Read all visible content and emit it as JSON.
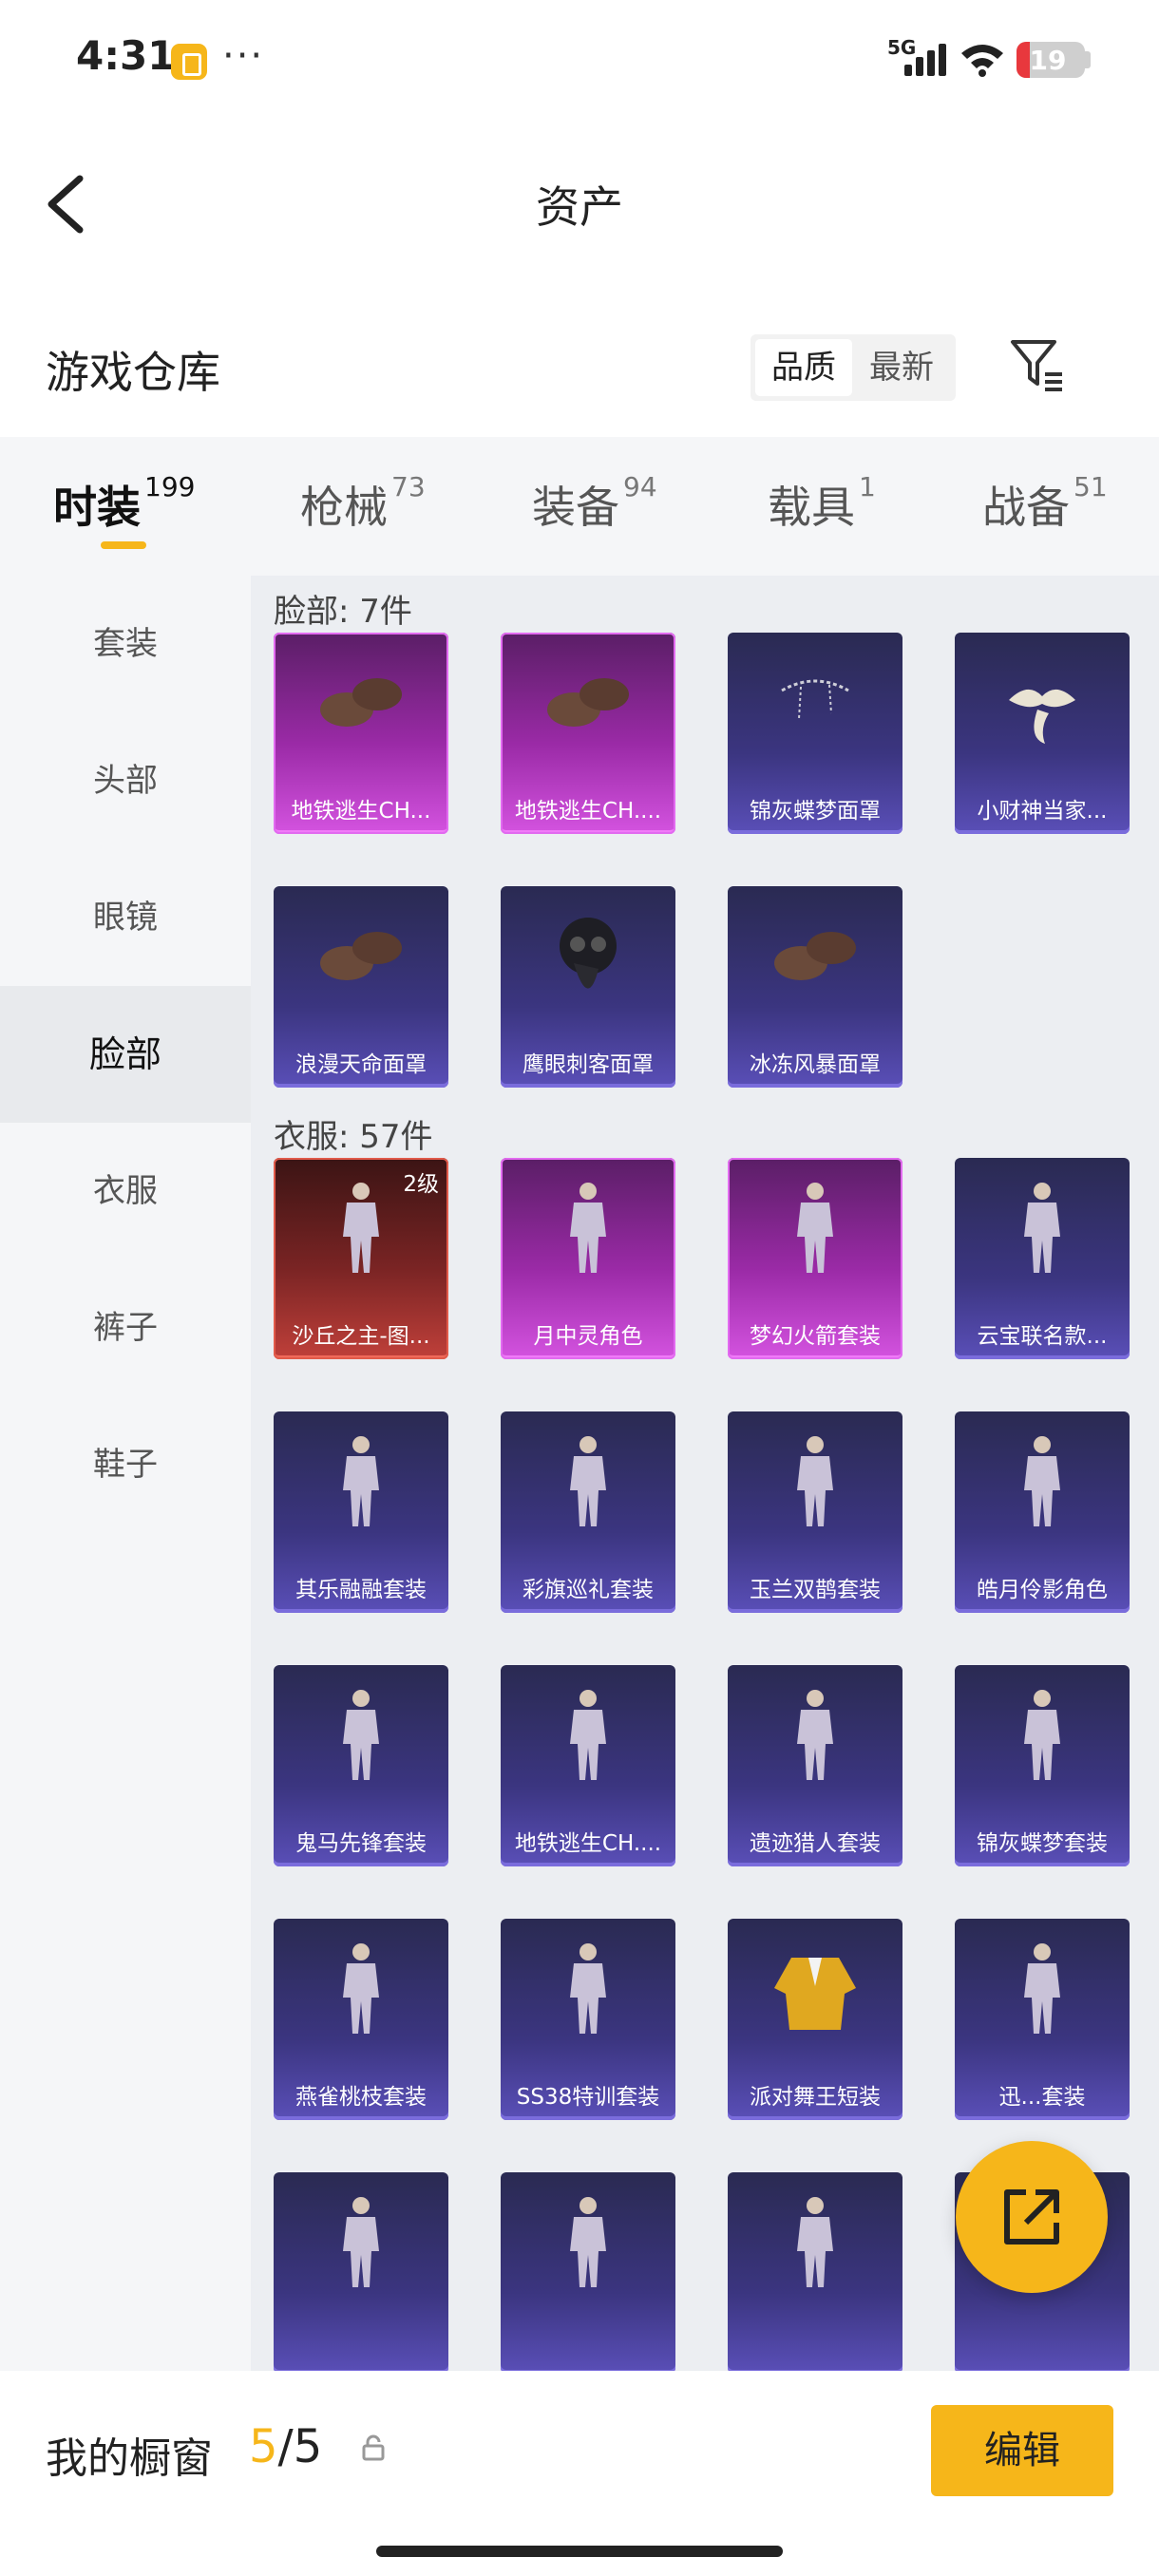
{
  "status_bar": {
    "time": "4:31",
    "network": "5G",
    "battery": "19",
    "battery_level": 0.19
  },
  "header": {
    "title": "资产"
  },
  "section": {
    "title": "游戏仓库",
    "sort_options": [
      "品质",
      "最新"
    ]
  },
  "tabs": [
    {
      "label": "时装",
      "count": "199"
    },
    {
      "label": "枪械",
      "count": "73"
    },
    {
      "label": "装备",
      "count": "94"
    },
    {
      "label": "载具",
      "count": "1"
    },
    {
      "label": "战备",
      "count": "51"
    }
  ],
  "sidebar": {
    "items": [
      {
        "label": "套装"
      },
      {
        "label": "头部"
      },
      {
        "label": "眼镜"
      },
      {
        "label": "脸部"
      },
      {
        "label": "衣服"
      },
      {
        "label": "裤子"
      },
      {
        "label": "鞋子"
      }
    ]
  },
  "groups": [
    {
      "title": "脸部: 7件",
      "items": [
        {
          "name": "地铁逃生CH...",
          "rarity": "pink",
          "icon": "face-mask-icon"
        },
        {
          "name": "地铁逃生CH....",
          "rarity": "pink",
          "icon": "bandana-icon"
        },
        {
          "name": "锦灰蝶梦面罩",
          "rarity": "purple",
          "icon": "chain-mask-icon"
        },
        {
          "name": "小财神当家...",
          "rarity": "purple",
          "icon": "mustache-icon"
        },
        {
          "name": "浪漫天命面罩",
          "rarity": "purple",
          "icon": "face-mask-icon"
        },
        {
          "name": "鹰眼刺客面罩",
          "rarity": "purple",
          "icon": "plague-mask-icon"
        },
        {
          "name": "冰冻风暴面罩",
          "rarity": "purple",
          "icon": "neck-gaiter-icon"
        }
      ]
    },
    {
      "title": "衣服: 57件",
      "items": [
        {
          "name": "沙丘之主-图...",
          "rarity": "red",
          "level": "2级",
          "icon": "outfit-icon"
        },
        {
          "name": "月中灵角色",
          "rarity": "pink",
          "icon": "outfit-icon"
        },
        {
          "name": "梦幻火箭套装",
          "rarity": "pink",
          "icon": "outfit-icon"
        },
        {
          "name": "云宝联名款...",
          "rarity": "purple",
          "icon": "outfit-icon"
        },
        {
          "name": "其乐融融套装",
          "rarity": "purple",
          "icon": "outfit-icon"
        },
        {
          "name": "彩旗巡礼套装",
          "rarity": "purple",
          "icon": "outfit-icon"
        },
        {
          "name": "玉兰双鹊套装",
          "rarity": "purple",
          "icon": "outfit-icon"
        },
        {
          "name": "皓月伶影角色",
          "rarity": "purple",
          "icon": "outfit-icon"
        },
        {
          "name": "鬼马先锋套装",
          "rarity": "purple",
          "icon": "outfit-icon"
        },
        {
          "name": "地铁逃生CH....",
          "rarity": "purple",
          "icon": "outfit-icon"
        },
        {
          "name": "遗迹猎人套装",
          "rarity": "purple",
          "icon": "outfit-icon"
        },
        {
          "name": "锦灰蝶梦套装",
          "rarity": "purple",
          "icon": "outfit-icon"
        },
        {
          "name": "燕雀桃枝套装",
          "rarity": "purple",
          "icon": "outfit-icon"
        },
        {
          "name": "SS38特训套装",
          "rarity": "purple",
          "icon": "outfit-icon"
        },
        {
          "name": "派对舞王短装",
          "rarity": "purple",
          "icon": "jacket-icon"
        },
        {
          "name": "迅...套装",
          "rarity": "purple",
          "icon": "outfit-icon"
        },
        {
          "name": "",
          "rarity": "purple",
          "icon": "outfit-icon"
        },
        {
          "name": "",
          "rarity": "purple",
          "icon": "outfit-icon"
        },
        {
          "name": "",
          "rarity": "purple",
          "icon": "outfit-icon"
        },
        {
          "name": "",
          "rarity": "purple",
          "icon": "jacket-icon"
        }
      ]
    }
  ],
  "bottom_bar": {
    "label": "我的橱窗",
    "current": "5",
    "total": "/5",
    "edit_label": "编辑"
  },
  "colors": {
    "accent": "#f6b61a",
    "rarity_purple": "#5a4fb8",
    "rarity_pink": "#d453e0",
    "rarity_red": "#c0403a"
  }
}
